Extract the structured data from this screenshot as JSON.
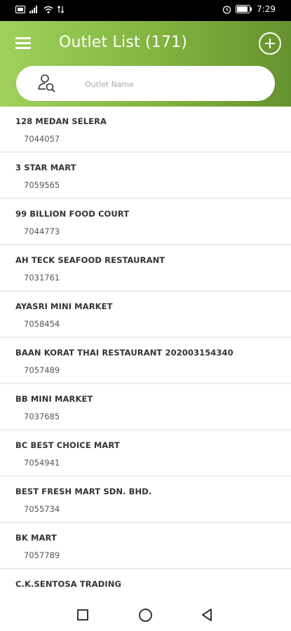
{
  "status_bar": {
    "time": "7:29",
    "icons": [
      "sim-card-icon",
      "signal-icon",
      "wifi-icon",
      "alarm-icon",
      "battery-icon"
    ],
    "battery_level": "88"
  },
  "header": {
    "title": "Outlet List (171)",
    "menu_icon": "hamburger-menu-icon",
    "add_icon": "add-circle-icon"
  },
  "search": {
    "placeholder": "Outlet Name",
    "icon": "user-search-icon"
  },
  "outlets": [
    {
      "name": "128 MEDAN SELERA",
      "code": "7044057"
    },
    {
      "name": "3 STAR MART",
      "code": "7059565"
    },
    {
      "name": "99 BILLION FOOD COURT",
      "code": "7044773"
    },
    {
      "name": "AH TECK SEAFOOD RESTAURANT",
      "code": "7031761"
    },
    {
      "name": "AYASRI MINI MARKET",
      "code": "7058454"
    },
    {
      "name": "BAAN KORAT THAI RESTAURANT 202003154340",
      "code": "7057489"
    },
    {
      "name": "BB MINI MARKET",
      "code": "7037685"
    },
    {
      "name": "BC BEST CHOICE MART",
      "code": "7054941"
    },
    {
      "name": "BEST FRESH MART SDN. BHD.",
      "code": "7055734"
    },
    {
      "name": "BK MART",
      "code": "7057789"
    },
    {
      "name": "C.K.SENTOSA TRADING",
      "code": ""
    }
  ],
  "nav": {
    "icons": [
      "recent-apps-square-icon",
      "home-circle-icon",
      "back-triangle-icon"
    ]
  },
  "colors": {
    "header_start": "#9fd15c",
    "header_end": "#65922e",
    "divider": "#ebebeb"
  }
}
